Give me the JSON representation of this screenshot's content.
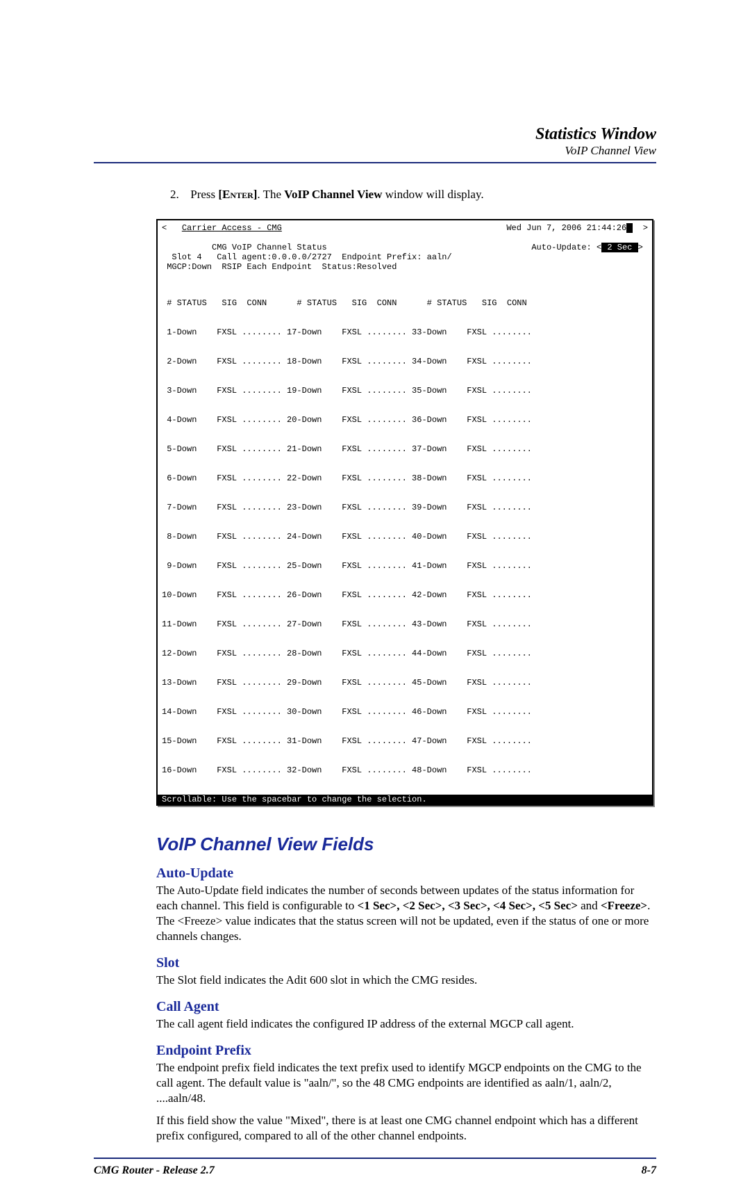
{
  "header": {
    "title": "Statistics Window",
    "subtitle": "VoIP Channel View"
  },
  "instruction": {
    "number": "2.",
    "prefix": "Press ",
    "key": "[Enter]",
    "middle": ". The ",
    "bold_name": "VoIP Channel View",
    "suffix": " window will display."
  },
  "terminal": {
    "left_arrow": "<",
    "app_title": "Carrier Access - CMG",
    "datetime": "Wed Jun  7, 2006 21:44:26",
    "right_arrow": ">",
    "status_title": "CMG VoIP Channel Status",
    "auto_update_label": "Auto-Update: <",
    "auto_update_value": " 2 Sec ",
    "auto_update_close": ">",
    "slot_line": "  Slot 4   Call agent:0.0.0.0/2727  Endpoint Prefix: aaln/",
    "mgcp_line": " MGCP:Down  RSIP Each Endpoint  Status:Resolved",
    "col_header": " # STATUS   SIG  CONN      # STATUS   SIG  CONN      # STATUS   SIG  CONN",
    "rows": [
      " 1-Down    FXSL ........ 17-Down    FXSL ........ 33-Down    FXSL ........",
      " 2-Down    FXSL ........ 18-Down    FXSL ........ 34-Down    FXSL ........",
      " 3-Down    FXSL ........ 19-Down    FXSL ........ 35-Down    FXSL ........",
      " 4-Down    FXSL ........ 20-Down    FXSL ........ 36-Down    FXSL ........",
      " 5-Down    FXSL ........ 21-Down    FXSL ........ 37-Down    FXSL ........",
      " 6-Down    FXSL ........ 22-Down    FXSL ........ 38-Down    FXSL ........",
      " 7-Down    FXSL ........ 23-Down    FXSL ........ 39-Down    FXSL ........",
      " 8-Down    FXSL ........ 24-Down    FXSL ........ 40-Down    FXSL ........",
      " 9-Down    FXSL ........ 25-Down    FXSL ........ 41-Down    FXSL ........",
      "10-Down    FXSL ........ 26-Down    FXSL ........ 42-Down    FXSL ........",
      "11-Down    FXSL ........ 27-Down    FXSL ........ 43-Down    FXSL ........",
      "12-Down    FXSL ........ 28-Down    FXSL ........ 44-Down    FXSL ........",
      "13-Down    FXSL ........ 29-Down    FXSL ........ 45-Down    FXSL ........",
      "14-Down    FXSL ........ 30-Down    FXSL ........ 46-Down    FXSL ........",
      "15-Down    FXSL ........ 31-Down    FXSL ........ 47-Down    FXSL ........",
      "16-Down    FXSL ........ 32-Down    FXSL ........ 48-Down    FXSL ........"
    ],
    "footer": "Scrollable: Use the spacebar to change the selection.                        "
  },
  "section_title": "VoIP Channel View Fields",
  "fields": {
    "auto_update": {
      "heading": "Auto-Update",
      "p1_a": "The Auto-Update field indicates the number of seconds between updates of the status information for each channel. This field is configurable to ",
      "p1_b": "<1 Sec>,  <2 Sec>, <3 Sec>, <4 Sec>, <5 Sec>",
      "p1_c": " and ",
      "p1_d": "<Freeze>",
      "p1_e": ". The <Freeze> value indicates that the status screen will not be updated, even if the status of one or more channels changes."
    },
    "slot": {
      "heading": "Slot",
      "text": "The Slot field indicates the Adit 600 slot in which the CMG resides."
    },
    "call_agent": {
      "heading": "Call Agent",
      "text": "The call agent field indicates the configured IP address of the external MGCP call agent."
    },
    "endpoint_prefix": {
      "heading": "Endpoint Prefix",
      "p1": "The endpoint prefix field indicates the text prefix used to identify MGCP endpoints on the CMG to the call agent. The default value is \"aaln/\", so the 48 CMG endpoints are identified as aaln/1, aaln/2, ....aaln/48.",
      "p2": "If this field show the value \"Mixed\", there is at least one CMG channel endpoint which has a different prefix configured, compared to all of the other channel endpoints."
    }
  },
  "footer": {
    "left": "CMG Router - Release 2.7",
    "right": "8-7"
  }
}
